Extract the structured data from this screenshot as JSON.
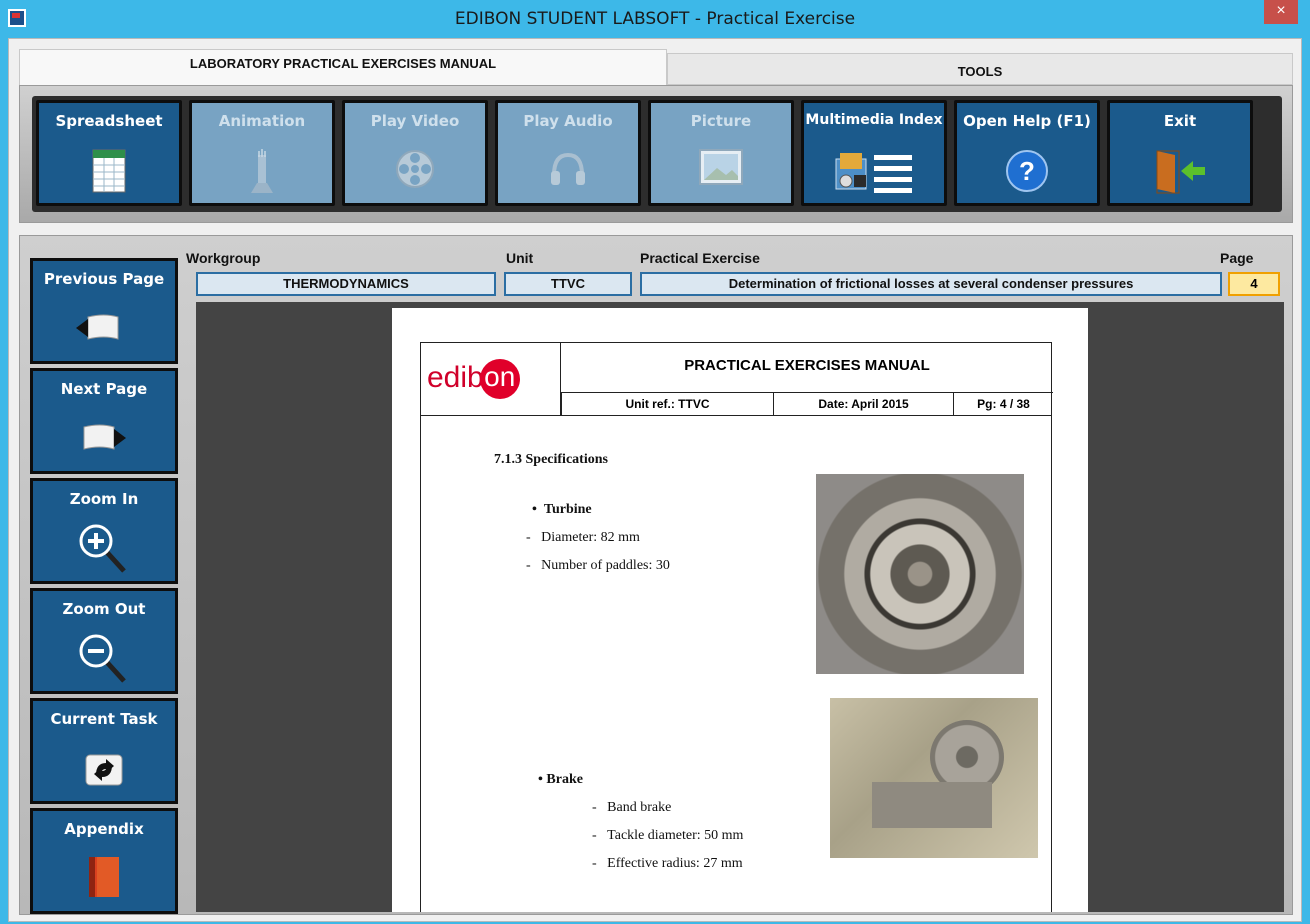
{
  "window": {
    "title": "EDIBON STUDENT LABSOFT - Practical Exercise",
    "close_label": "×"
  },
  "tabs": [
    {
      "label": "LABORATORY PRACTICAL EXERCISES MANUAL",
      "active": true
    },
    {
      "label": "TOOLS",
      "active": false
    }
  ],
  "toolbar": [
    {
      "label": "Spreadsheet",
      "icon": "spreadsheet-icon",
      "enabled": true
    },
    {
      "label": "Animation",
      "icon": "animation-icon",
      "enabled": false
    },
    {
      "label": "Play Video",
      "icon": "film-reel-icon",
      "enabled": false
    },
    {
      "label": "Play Audio",
      "icon": "headphones-icon",
      "enabled": false
    },
    {
      "label": "Picture",
      "icon": "picture-icon",
      "enabled": false
    },
    {
      "label": "Multimedia Index",
      "icon": "multimedia-index-icon",
      "enabled": true
    },
    {
      "label": "Open Help (F1)",
      "icon": "help-icon",
      "enabled": true
    },
    {
      "label": "Exit",
      "icon": "exit-door-icon",
      "enabled": true
    }
  ],
  "nav": [
    {
      "label": "Previous Page",
      "icon": "book-previous-icon"
    },
    {
      "label": "Next Page",
      "icon": "book-next-icon"
    },
    {
      "label": "Zoom In",
      "icon": "zoom-in-icon"
    },
    {
      "label": "Zoom Out",
      "icon": "zoom-out-icon"
    },
    {
      "label": "Current Task",
      "icon": "refresh-task-icon"
    },
    {
      "label": "Appendix",
      "icon": "appendix-book-icon"
    }
  ],
  "info": {
    "workgroup_label": "Workgroup",
    "workgroup_value": "THERMODYNAMICS",
    "unit_label": "Unit",
    "unit_value": "TTVC",
    "exercise_label": "Practical Exercise",
    "exercise_value": "Determination of frictional losses at several condenser pressures",
    "page_label": "Page",
    "page_value": "4"
  },
  "document": {
    "logo_text": "edib",
    "logo_circle": "on",
    "manual_title": "PRACTICAL EXERCISES MANUAL",
    "unit_ref": "Unit ref.: TTVC",
    "date": "Date: April 2015",
    "pg": "Pg: 4 / 38",
    "section_title": "7.1.3  Specifications",
    "turbine_heading": "Turbine",
    "turbine_items": [
      "Diameter: 82 mm",
      "Number of paddles: 30"
    ],
    "brake_heading": "Brake",
    "brake_items": [
      "Band brake",
      "Tackle diameter: 50 mm",
      "Effective radius: 27 mm"
    ]
  }
}
